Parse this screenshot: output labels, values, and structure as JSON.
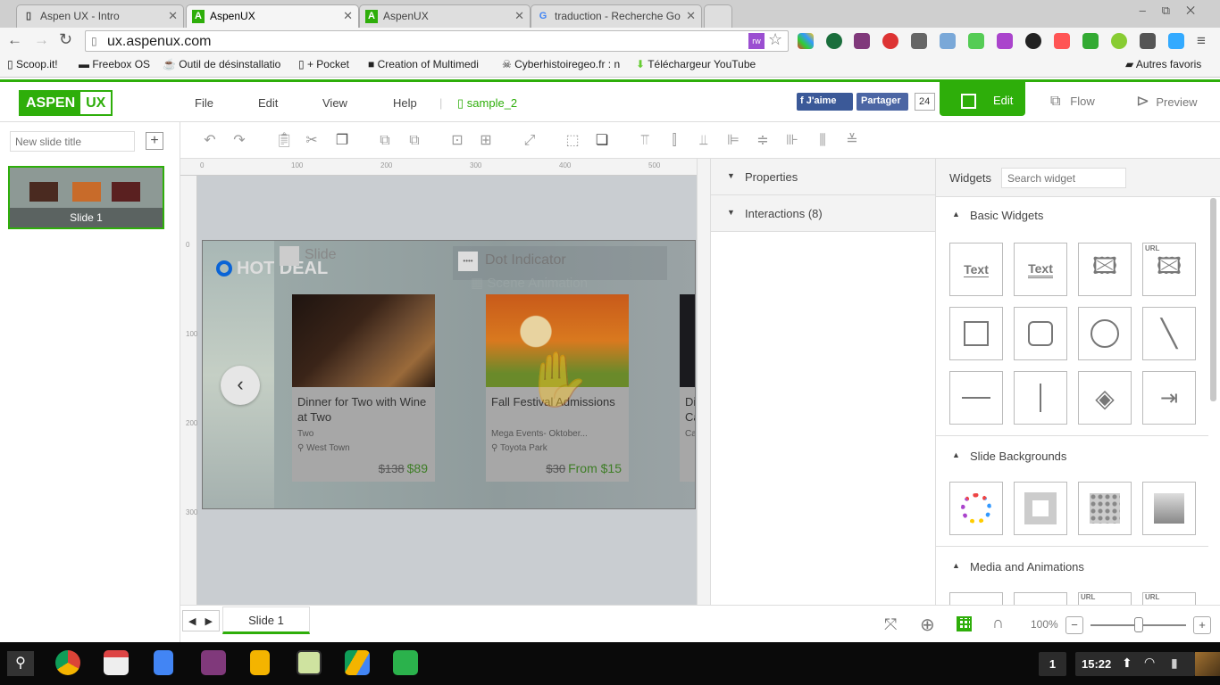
{
  "browser": {
    "tabs": [
      {
        "title": "Aspen UX - Intro",
        "icon": "page-icon"
      },
      {
        "title": "AspenUX",
        "icon": "A",
        "active": true
      },
      {
        "title": "AspenUX",
        "icon": "A"
      },
      {
        "title": "traduction - Recherche Go",
        "icon": "G"
      }
    ],
    "url": "ux.aspenux.com",
    "bookmarks": [
      "Scoop.it!",
      "Freebox OS",
      "Outil de désinstallatio",
      "+ Pocket",
      "Creation of Multimedi",
      "Cyberhistoiregeo.fr : n",
      "Téléchargeur YouTube"
    ],
    "other_bookmarks": "Autres favoris",
    "ext_badge": "rw"
  },
  "app": {
    "logo": [
      "ASPEN",
      "UX"
    ],
    "menu": [
      "File",
      "Edit",
      "View",
      "Help"
    ],
    "file_name": "sample_2",
    "fb_like": "J'aime",
    "fb_share": "Partager",
    "fb_count": "24",
    "modes": {
      "edit": "Edit",
      "flow": "Flow",
      "preview": "Preview"
    },
    "brand_color": "#2eae0a"
  },
  "left": {
    "slide_title_placeholder": "New slide title",
    "add": "+",
    "thumb_label": "Slide 1"
  },
  "ruler": {
    "h": [
      "0",
      "100",
      "200",
      "300",
      "400",
      "500"
    ],
    "v": [
      "0",
      "100",
      "200",
      "300"
    ]
  },
  "slide": {
    "hot_deal": "HOT DEAL",
    "overlay_slide": "Slide",
    "overlay_dot": "Dot Indicator",
    "overlay_scene": "Scene Animation",
    "cards": [
      {
        "title": "Dinner for Two with Wine at Two",
        "sub": "Two",
        "loc": "West Town",
        "old": "$138",
        "price": "$89"
      },
      {
        "title": "Fall Festival Admissions",
        "sub": "Mega Events- Oktober...",
        "loc": "Toyota Park",
        "old": "$30",
        "price": "From $15"
      },
      {
        "title": "Di Ca",
        "sub": "Ca",
        "loc": "",
        "old": "",
        "price": ""
      }
    ]
  },
  "props": {
    "properties": "Properties",
    "interactions": "Interactions (8)"
  },
  "widgets": {
    "title": "Widgets",
    "search_placeholder": "Search widget",
    "basic": "Basic Widgets",
    "backgrounds": "Slide Backgrounds",
    "media": "Media and Animations",
    "text1": "Text",
    "text2": "Text",
    "url": "URL"
  },
  "bottom": {
    "slide_tab": "Slide 1",
    "zoom": "100%",
    "zoom_level": 0.5,
    "minus": "−",
    "plus": "+"
  },
  "taskbar": {
    "workspace": "1",
    "time": "15:22"
  }
}
